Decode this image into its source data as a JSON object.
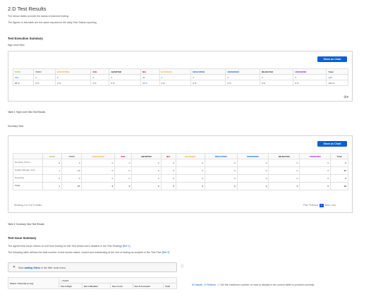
{
  "page": {
    "title": "2.D Test Results",
    "intro1": "The below tables provide the status of planned testing.",
    "intro2": "The figures in this table are the same reported in the daily Test Status reporting."
  },
  "execution": {
    "heading": "Test Execution Summary",
    "high_level_label": "High Level View",
    "show_chart": "Show as Chart",
    "high_level_headers": [
      "PASS",
      "TODO",
      "EXECUTING",
      "FAIL",
      "ABORTED",
      "N/A",
      "BLOCKED",
      "DESCOPED",
      "DEFERRED",
      "REJECTED",
      "UNKNOWN",
      "Total"
    ],
    "header_colors": [
      "#8bbf3d",
      "#666666",
      "#f5a623",
      "#d0021b",
      "#333333",
      "#d0021b",
      "#f5a623",
      "#0b5fd4",
      "#0b5fd4",
      "#333333",
      "#9013fe",
      "#333333"
    ],
    "high_level_rows": [
      [
        "100",
        "0",
        "0",
        "0",
        "0",
        "22",
        "0",
        "0",
        "0",
        "0",
        "0",
        "122"
      ],
      [
        "88 %",
        "0 %",
        "0 %",
        "0 %",
        "0 %",
        "18 %",
        "0 %",
        "0 %",
        "0 %",
        "0 %",
        "0 %",
        "100 %"
      ]
    ],
    "table2_caption": "Table 2: High Level View Test Results",
    "summary_label": "Summary View",
    "summary_headers": [
      "",
      "PASS",
      "TODO",
      "EXECUTING",
      "FAIL",
      "ABORTED",
      "N/A",
      "BLOCKED",
      "DESCOPED",
      "DEFERRED",
      "REJECTED",
      "UNKNOWN",
      "Total"
    ],
    "summary_rows": [
      [
        "Demand_CCar e",
        "0",
        "0",
        "0",
        "0",
        "0",
        "0",
        "0",
        "0",
        "0",
        "0",
        "0",
        "0"
      ],
      [
        "Quality Manage ment",
        "1",
        "19",
        "0",
        "0",
        "0",
        "0",
        "0",
        "0",
        "0",
        "0",
        "0",
        "20"
      ],
      [
        "Reporting",
        "0",
        "0",
        "0",
        "0",
        "0",
        "0",
        "0",
        "0",
        "0",
        "0",
        "0",
        "0"
      ],
      [
        "Total",
        "1",
        "27",
        "0",
        "0",
        "0",
        "0",
        "0",
        "0",
        "0",
        "0",
        "0",
        "28"
      ]
    ],
    "showing": "Showing 1 to 3 of 3 entries",
    "pager": {
      "first": "First",
      "previous": "Previous",
      "current": "1",
      "next": "Next",
      "last": "Last"
    },
    "table3_caption": "Table 3: Summary View Test Results"
  },
  "issues": {
    "heading": "Test Issue Summary",
    "line1_prefix": "The agreed test issue criteria on exit from testing for this Test phase were detailed in the Test Strategy",
    "line1_ref": "[Ref 1]",
    "line2_prefix": "The following table defines the total number of test issues raised, closed and outstanding at the end of testing as scripted in the Test Plan",
    "line2_ref": "[Ref 2]",
    "filter_prefix": "Start",
    "filter_link": "adding filters",
    "filter_suffix": "in the filter tools menu",
    "issues_count": "51 issues",
    "refresh": "Refresh",
    "max_rows": "Set the maximum number of rows to display in the source table to proceed correctly.",
    "table_col1": "Status / Severity (x-rsy)",
    "table_count": "– Count",
    "severity_cols": [
      "Sev-2-High",
      "Sev-3-Medium",
      "Sev-4-Low",
      "Sev-5-Cosmetic",
      "Total"
    ]
  }
}
